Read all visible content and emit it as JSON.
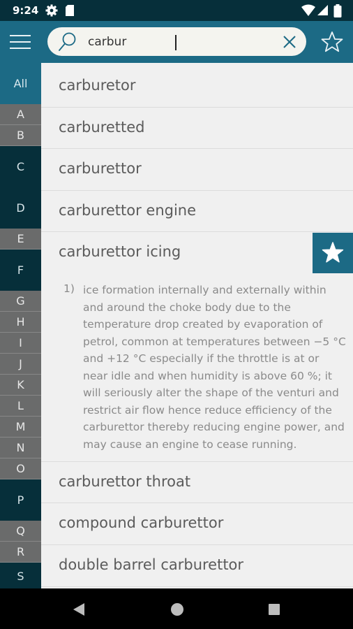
{
  "status_bar": {
    "time": "9:24"
  },
  "search": {
    "value": "carbur"
  },
  "sidebar": {
    "all_label": "All",
    "letters": [
      {
        "label": "A",
        "style": "gray"
      },
      {
        "label": "B",
        "style": "gray"
      },
      {
        "label": "C",
        "style": "dark"
      },
      {
        "label": "D",
        "style": "dark"
      },
      {
        "label": "E",
        "style": "gray"
      },
      {
        "label": "F",
        "style": "dark"
      },
      {
        "label": "G",
        "style": "gray"
      },
      {
        "label": "H",
        "style": "gray"
      },
      {
        "label": "I",
        "style": "gray"
      },
      {
        "label": "J",
        "style": "gray"
      },
      {
        "label": "K",
        "style": "gray"
      },
      {
        "label": "L",
        "style": "gray"
      },
      {
        "label": "M",
        "style": "gray"
      },
      {
        "label": "N",
        "style": "gray"
      },
      {
        "label": "O",
        "style": "gray"
      },
      {
        "label": "P",
        "style": "dark"
      },
      {
        "label": "Q",
        "style": "gray"
      },
      {
        "label": "R",
        "style": "gray"
      },
      {
        "label": "S",
        "style": "dark"
      }
    ]
  },
  "results": [
    {
      "term": "carburetor"
    },
    {
      "term": "carburetted"
    },
    {
      "term": "carburettor"
    },
    {
      "term": "carburettor engine"
    },
    {
      "term": "carburettor icing",
      "expanded": true,
      "definition_number": "1)",
      "definition": "ice formation internally and externally within and around the choke body due to the temperature drop created by evaporation of petrol, common at temperatures between −5 °C and +12 °C especially if the throttle is at or near idle and when humidity is above 60 %; it will seriously alter the shape of the venturi and restrict air flow hence reduce efficiency of the carburettor thereby reducing engine power, and may cause an engine to cease running."
    },
    {
      "term": "carburettor throat"
    },
    {
      "term": "compound carburettor"
    },
    {
      "term": "double barrel carburettor"
    }
  ],
  "colors": {
    "appbar": "#1c6a85",
    "sidebar_dark": "#062f3a",
    "sidebar_gray": "#6a6b6b",
    "list_bg": "#f0f0f0"
  },
  "icons": {
    "menu": "hamburger-menu-icon",
    "search": "magnifier-icon",
    "clear": "close-icon",
    "favorite": "star-outline-icon",
    "favorite_filled": "star-filled-icon",
    "nav_back": "triangle-back-icon",
    "nav_home": "circle-home-icon",
    "nav_recents": "square-recents-icon"
  }
}
